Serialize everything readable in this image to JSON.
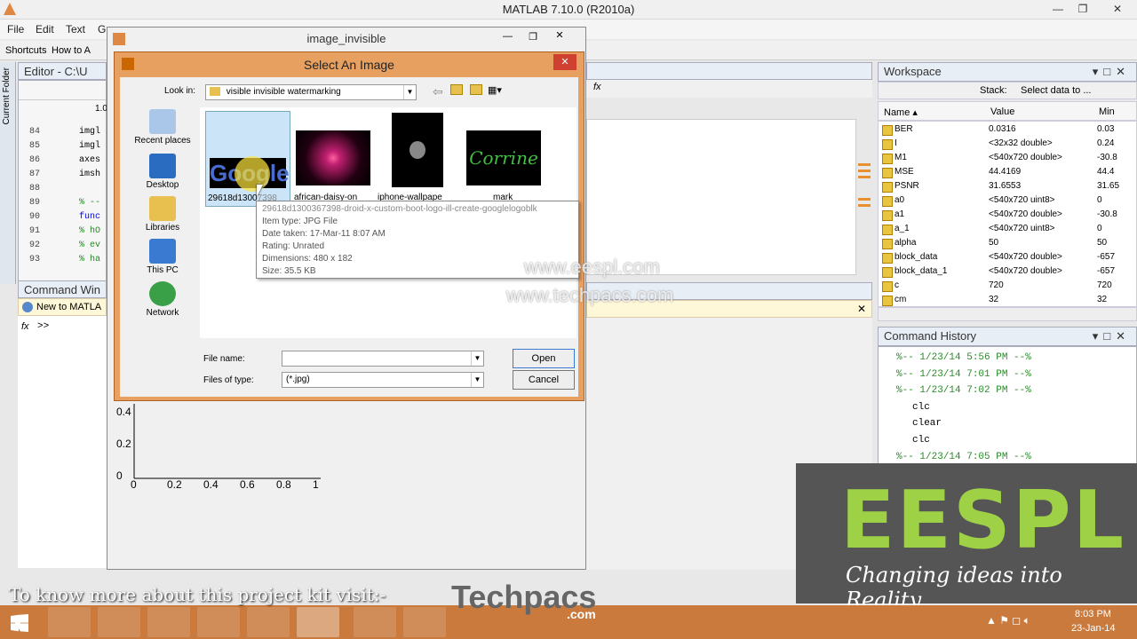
{
  "window": {
    "title": "MATLAB  7.10.0 (R2010a)"
  },
  "menu": [
    "File",
    "Edit",
    "Text",
    "G"
  ],
  "shortcuts": {
    "label": "Shortcuts",
    "howto": "How to A"
  },
  "editor": {
    "title": "Editor - C:\\U",
    "zoom": "1.0",
    "lines": [
      {
        "num": "84",
        "code": "imgl"
      },
      {
        "num": "85",
        "code": "imgl"
      },
      {
        "num": "86",
        "code": "axes"
      },
      {
        "num": "87",
        "code": "imsh"
      },
      {
        "num": "88",
        "code": ""
      },
      {
        "num": "89",
        "code": "% --"
      },
      {
        "num": "90",
        "code": "func"
      },
      {
        "num": "91",
        "code": "% hO"
      },
      {
        "num": "92",
        "code": "% ev"
      },
      {
        "num": "93",
        "code": "% ha"
      }
    ]
  },
  "current_folder_label": "Current Folder",
  "command_window": {
    "title": "Command Win",
    "notice": "New to MATLA",
    "prompt": ">>"
  },
  "figure_window": {
    "title": "image_invisible"
  },
  "dialog": {
    "title": "Select An Image",
    "look_in_label": "Look in:",
    "look_in_value": "visible invisible watermarking",
    "places": [
      "Recent places",
      "Desktop",
      "Libraries",
      "This PC",
      "Network"
    ],
    "files": [
      {
        "name": "29618d1300",
        "suffix": "7398",
        "text": "Google"
      },
      {
        "name": "african-daisy-on",
        "text": ""
      },
      {
        "name": "iphone-wallpape",
        "text": ""
      },
      {
        "name": "mark",
        "text": "Corrine"
      }
    ],
    "file_name_label": "File name:",
    "file_name_value": "",
    "file_type_label": "Files of type:",
    "file_type_value": "(*.jpg)",
    "open_label": "Open",
    "cancel_label": "Cancel"
  },
  "tooltip": {
    "name": "29618d1300367398-droid-x-custom-boot-logo-ill-create-googlelogoblk",
    "type": "Item type: JPG File",
    "date": "Date taken: 17-Mar-11 8:07 AM",
    "rating": "Rating: Unrated",
    "dimensions": "Dimensions: 480 x 182",
    "size": "Size: 35.5 KB"
  },
  "axes": {
    "y_ticks": [
      "0.4",
      "0.2",
      "0"
    ],
    "x_ticks": [
      "0",
      "0.2",
      "0.4",
      "0.6",
      "0.8",
      "1"
    ]
  },
  "workspace": {
    "title": "Workspace",
    "stack_label": "Stack:",
    "select_label": "Select data to ...",
    "columns": [
      "Name ▴",
      "Value",
      "Min"
    ],
    "rows": [
      {
        "name": "BER",
        "value": "0.0316",
        "min": "0.03"
      },
      {
        "name": "I",
        "value": "<32x32 double>",
        "min": "0.24"
      },
      {
        "name": "M1",
        "value": "<540x720 double>",
        "min": "-30.8"
      },
      {
        "name": "MSE",
        "value": "44.4169",
        "min": "44.4"
      },
      {
        "name": "PSNR",
        "value": "31.6553",
        "min": "31.65"
      },
      {
        "name": "a0",
        "value": "<540x720 uint8>",
        "min": "0"
      },
      {
        "name": "a1",
        "value": "<540x720 double>",
        "min": "-30.8"
      },
      {
        "name": "a_1",
        "value": "<540x720 uint8>",
        "min": "0"
      },
      {
        "name": "alpha",
        "value": "50",
        "min": "50"
      },
      {
        "name": "block_data",
        "value": "<540x720 double>",
        "min": "-657"
      },
      {
        "name": "block_data_1",
        "value": "<540x720 double>",
        "min": "-657"
      },
      {
        "name": "c",
        "value": "720",
        "min": "720"
      },
      {
        "name": "cm",
        "value": "32",
        "min": "32"
      }
    ]
  },
  "command_history": {
    "title": "Command History",
    "entries": [
      "%-- 1/23/14  5:56 PM --%",
      "%-- 1/23/14  7:01 PM --%",
      "%-- 1/23/14  7:02 PM --%",
      "clc",
      "clear",
      "clc",
      "%-- 1/23/14  7:05 PM --%"
    ]
  },
  "overlays": {
    "watermark1": "www.eespl.com",
    "watermark2": "www.techpacs.com",
    "eespl_logo": "EESPL",
    "eespl_tagline": "Changing ideas into Reality",
    "visit_text": "To know more about this project kit visit:-",
    "techpacs_logo": "Techpacs",
    "techpacs_com": ".com"
  },
  "taskbar": {
    "time": "8:03 PM",
    "date": "23-Jan-14"
  },
  "colors": {
    "dialog_frame": "#e8a060",
    "eespl_green": "#9fd146",
    "taskbar": "#c97a3c",
    "history_green": "#2a8a2a"
  }
}
